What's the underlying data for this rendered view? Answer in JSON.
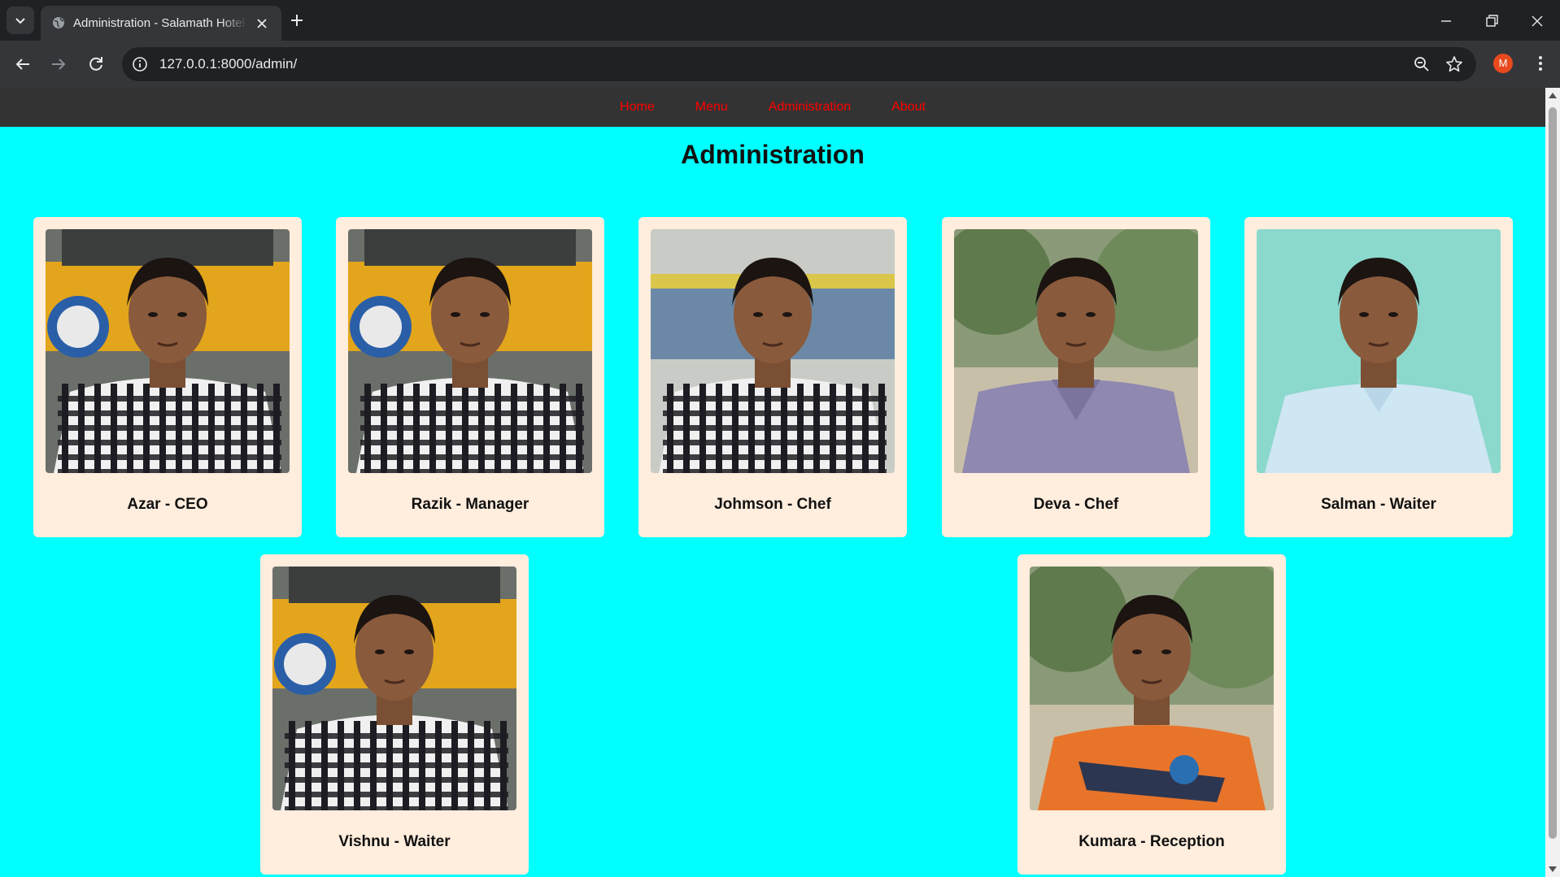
{
  "browser": {
    "tab_title": "Administration - Salamath Hotel",
    "url": "127.0.0.1:8000/admin/",
    "profile_initial": "M",
    "profile_color": "#e8491d"
  },
  "nav": {
    "items": [
      "Home",
      "Menu",
      "Administration",
      "About"
    ],
    "link_color": "#ff0000",
    "bar_color": "#333333"
  },
  "page": {
    "title": "Administration",
    "background": "#00ffff",
    "card_color": "#ffeddd"
  },
  "staff": [
    {
      "caption": "Azar - CEO",
      "photo": "person-photo",
      "bg": "school-bus",
      "shirt": "checked"
    },
    {
      "caption": "Razik - Manager",
      "photo": "person-photo",
      "bg": "school-bus",
      "shirt": "checked"
    },
    {
      "caption": "Johmson - Chef",
      "photo": "person-photo",
      "bg": "wall",
      "shirt": "checked"
    },
    {
      "caption": "Deva - Chef",
      "photo": "person-photo",
      "bg": "trees",
      "shirt": "lavender"
    },
    {
      "caption": "Salman - Waiter",
      "photo": "person-photo",
      "bg": "teal-wall",
      "shirt": "light-blue"
    },
    {
      "caption": "Vishnu - Waiter",
      "photo": "person-photo",
      "bg": "school-bus",
      "shirt": "checked"
    },
    {
      "caption": "Kumara - Reception",
      "photo": "person-photo",
      "bg": "trees",
      "shirt": "orange-jersey"
    }
  ]
}
